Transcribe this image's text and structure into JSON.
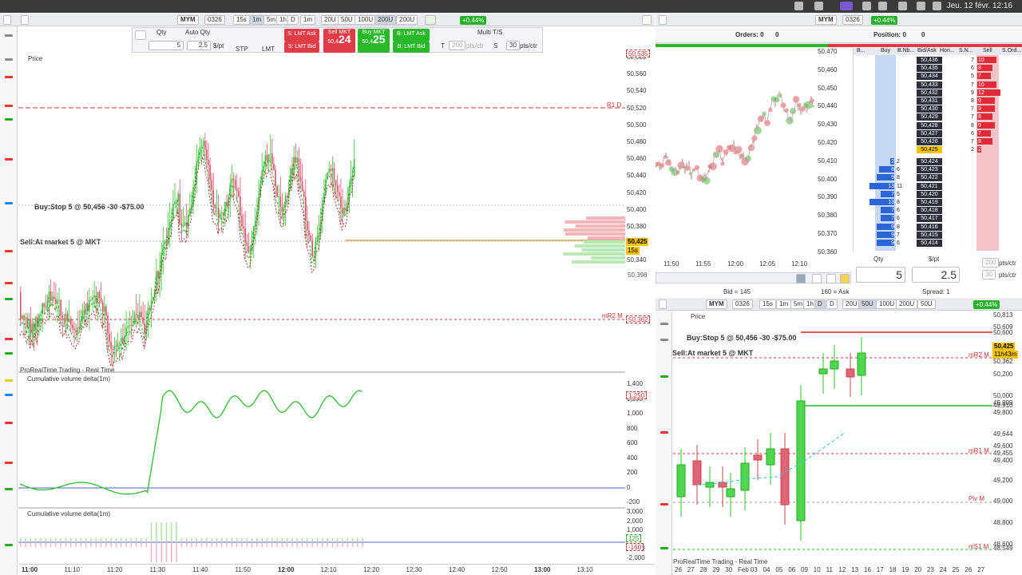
{
  "menubar": {
    "datetime": "Jeu. 12 févr.  12:16"
  },
  "main_window": {
    "symbol": "MYM",
    "contract": "0326",
    "timeframes": [
      "15s",
      "1m",
      "5m",
      "1h",
      "D"
    ],
    "interval": "1m",
    "units": [
      "20U",
      "50U",
      "100U",
      "200U"
    ],
    "units_select": "200U",
    "change_pct": "+0.44%"
  },
  "order_panel": {
    "qty_label": "Qty",
    "auto_qty_label": "Auto Qty",
    "qty_value": "5",
    "dollar_per_pt": "2.5",
    "per_pt_label": "$/pt",
    "stp_label": "STP",
    "lmt_label": "LMT",
    "s_lmt_ask": "S: LMT Ask",
    "s_lmt_bid": "S: LMT Bid",
    "sell_mkt": "Sell MKT",
    "sell_price_small": "50,4",
    "sell_price_big": "24",
    "buy_mkt": "Buy MKT",
    "buy_price_small": "50,4",
    "buy_price_big": "25",
    "b_lmt_ask": "B: LMT Ask",
    "b_lmt_bid": "B: LMT Bid",
    "multi_ts": "Multi T/S",
    "t_label": "T",
    "t_value": "200",
    "pts_ctr": "pts/ctr",
    "s_label": "S",
    "s_value": "30"
  },
  "main_chart": {
    "price_label": "Price",
    "buy_stop": "Buy:Stop 5 @ 50,456  -30  -$75.00",
    "sell_market": "Sell:At market 5 @ MKT",
    "r1_label": "R1 D",
    "r1_value": "50,535",
    "mr2_label": "mR2 M",
    "mr2_value": "50,362",
    "last_price": "50,425",
    "countdown": "15s",
    "mid_value": "50,398",
    "watermark": "ProRealTime Trading - Real Time",
    "price_axis": [
      "50,580",
      "50,560",
      "50,540",
      "50,520",
      "50,500",
      "50,480",
      "50,460",
      "50,440",
      "50,420",
      "50,400",
      "50,380",
      "50,360",
      "50,340",
      "50,320"
    ],
    "cvd_title": "Cumulative volume delta(1m)",
    "cvd_axis": [
      "1,400",
      "1,200",
      "1,000",
      "800",
      "600",
      "400",
      "200",
      "0",
      "-200"
    ],
    "cvd_tag": "1,250",
    "cvd2_title": "Cumulative volume delta(1m)",
    "cvd2_axis": [
      "3,000",
      "2,000",
      "1,000",
      "0",
      "-1,000",
      "-2,000"
    ],
    "cvd2_tags": [
      "125",
      "-160"
    ],
    "time_axis": [
      "11:00",
      "11:10",
      "11:20",
      "11:30",
      "11:40",
      "11:50",
      "12:00",
      "12:10",
      "12:20",
      "12:30",
      "12:40",
      "12:50",
      "13:00",
      "13:10"
    ]
  },
  "top_right": {
    "orders": "Orders: 0",
    "orders_sub": "0",
    "position": "Position: 0",
    "position_sub": "0",
    "tick_axis": [
      "50,470",
      "50,460",
      "50,450",
      "50,440",
      "50,430",
      "50,420",
      "50,410",
      "50,400",
      "50,390",
      "50,380",
      "50,370",
      "50,360"
    ],
    "tick_time": [
      "11:50",
      "11:55",
      "12:00",
      "12:05",
      "12:10"
    ],
    "bid": "Bid = 145",
    "ask": "160 = Ask",
    "spread": "Spread: 1",
    "dom_headers": [
      "B...",
      "Buy",
      "B.Nb...",
      "Bid/Ask",
      "Hori...",
      "S.N...",
      "Sell",
      "S.Ord..."
    ],
    "dom_asks": [
      {
        "price": "50,436",
        "nb": "7",
        "size": "10"
      },
      {
        "price": "50,435",
        "nb": "6",
        "size": "8"
      },
      {
        "price": "50,434",
        "nb": "5",
        "size": "7"
      },
      {
        "price": "50,433",
        "nb": "7",
        "size": "10"
      },
      {
        "price": "50,432",
        "nb": "9",
        "size": "12"
      },
      {
        "price": "50,431",
        "nb": "8",
        "size": "9"
      },
      {
        "price": "50,430",
        "nb": "7",
        "size": "9"
      },
      {
        "price": "50,429",
        "nb": "7",
        "size": "8"
      },
      {
        "price": "50,428",
        "nb": "8",
        "size": "9"
      },
      {
        "price": "50,427",
        "nb": "6",
        "size": "7"
      },
      {
        "price": "50,426",
        "nb": "7",
        "size": "8"
      },
      {
        "price": "50,425",
        "nb": "2",
        "size": "2"
      }
    ],
    "dom_bids": [
      {
        "price": "50,424",
        "nb": "2",
        "size": "2"
      },
      {
        "price": "50,423",
        "nb": "6",
        "size": "8"
      },
      {
        "price": "50,422",
        "nb": "8",
        "size": "9"
      },
      {
        "price": "50,421",
        "nb": "11",
        "size": "13"
      },
      {
        "price": "50,420",
        "nb": "5",
        "size": "7"
      },
      {
        "price": "50,419",
        "nb": "8",
        "size": "13"
      },
      {
        "price": "50,418",
        "nb": "6",
        "size": "7"
      },
      {
        "price": "50,417",
        "nb": "6",
        "size": "7"
      },
      {
        "price": "50,416",
        "nb": "8",
        "size": "9"
      },
      {
        "price": "50,415",
        "nb": "7",
        "size": "9"
      },
      {
        "price": "50,414",
        "nb": "6",
        "size": "9"
      }
    ],
    "qty_label": "Qty",
    "per_pt_label": "$/pt",
    "qty": "5",
    "dollar_per_pt": "2.5",
    "t_value": "200",
    "s_value": "30",
    "pts_ctr": "pts/ctr"
  },
  "bottom_right": {
    "symbol": "MYM",
    "contract": "0326",
    "timeframes": [
      "15s",
      "1m",
      "5m",
      "1h",
      "D"
    ],
    "interval": "D",
    "units": [
      "20U",
      "50U",
      "100U",
      "200U"
    ],
    "units_select": "50U",
    "change_pct": "+0.44%",
    "price_label": "Price",
    "buy_stop": "Buy:Stop 5 @ 50,456  -30  -$75.00",
    "sell_market": "Sell:At market 5 @ MKT",
    "watermark": "ProRealTime Trading - Real Time",
    "price_axis": [
      "50,813",
      "50,609",
      "50,600",
      "50,425",
      "50,362",
      "50,200",
      "50,000",
      "49,909",
      "49,910",
      "49,800",
      "49,644",
      "49,600",
      "49,455",
      "49,400",
      "49,200",
      "49,000",
      "48,800",
      "48,600",
      "48,549"
    ],
    "level_labels": [
      "mR2 M",
      "mR1 M",
      "Piv M",
      "mS1 M"
    ],
    "last_price": "50,425",
    "countdown": "11h43m",
    "date_axis": [
      "26",
      "27",
      "28",
      "29",
      "30",
      "Feb",
      "03",
      "04",
      "05",
      "06",
      "09",
      "10",
      "11",
      "12",
      "13",
      "16",
      "17",
      "18",
      "19",
      "20",
      "23",
      "24",
      "25",
      "26",
      "27"
    ]
  }
}
